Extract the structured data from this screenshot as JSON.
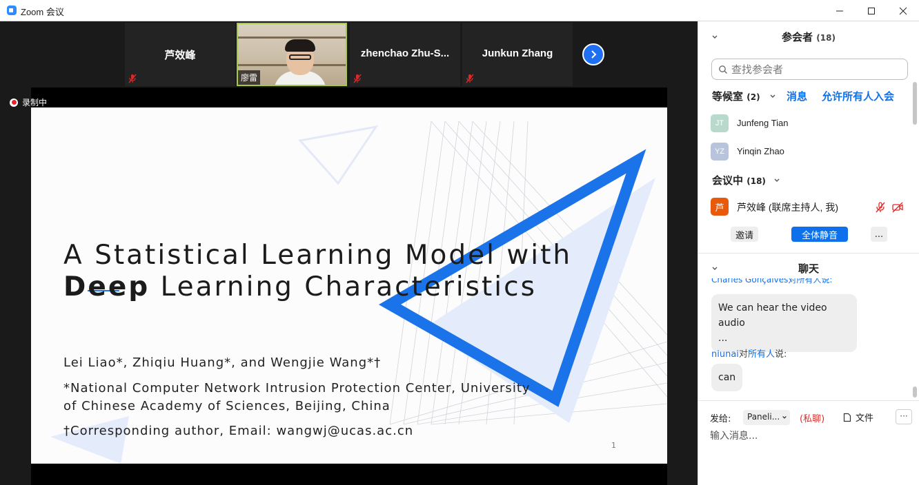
{
  "window": {
    "title": "Zoom 会议",
    "minimize_icon": "minimize-icon",
    "maximize_icon": "maximize-icon",
    "close_icon": "close-icon"
  },
  "participants_strip": [
    {
      "name": "芦效峰",
      "muted": true
    },
    {
      "name": "廖雷",
      "video": true
    },
    {
      "name": "zhenchao  Zhu-S...",
      "muted": true
    },
    {
      "name": "Junkun Zhang",
      "muted": true
    }
  ],
  "recording": {
    "label": "录制中"
  },
  "slide": {
    "title_line1": "A Statistical Learning Model with",
    "title_line2_bold": "Deep",
    "title_line2_rest": " Learning Characteristics",
    "authors": "Lei Liao*, Zhiqiu Huang*, and Wengjie Wang*†",
    "affiliation_line1": "*National Computer Network Intrusion Protection Center, University",
    "affiliation_line2": "of Chinese Academy of Sciences, Beijing, China",
    "corresponding": "†Corresponding author, Email: wangwj@ucas.ac.cn",
    "page_number": "1",
    "accent_color": "#1a73e8"
  },
  "panel": {
    "participants_header": "参会者",
    "participants_count": "(18)",
    "search_placeholder": "查找参会者",
    "waiting_room_label": "等候室",
    "waiting_room_count": "(2)",
    "message_link": "消息",
    "admit_all_link": "允许所有人入会",
    "waiting": [
      {
        "initials": "JT",
        "name": "Junfeng Tian",
        "color": "#b9d9cc"
      },
      {
        "initials": "YZ",
        "name": "Yinqin Zhao",
        "color": "#b8c4dc"
      }
    ],
    "in_meeting_label": "会议中",
    "in_meeting_count": "(18)",
    "host": {
      "initials": "芦",
      "name": "芦效峰 (联席主持人, 我)",
      "color": "#e8590c"
    },
    "invite_button": "邀请",
    "mute_all_button": "全体静音",
    "more_button": "...",
    "chat_header": "聊天",
    "chat_clipped_sender": "Charles Gonçalves对所有人说:",
    "chat_messages": [
      {
        "text": "We can hear the video audio\n..."
      },
      {
        "sender_name": "niunai",
        "sender_to": "对",
        "sender_target": "所有人",
        "sender_suffix": "说:",
        "text": "can"
      }
    ],
    "send_to_label": "发给:",
    "send_to_value": "Paneli...",
    "private_label": "(私聊)",
    "file_label": "文件",
    "more_footer": "···",
    "message_placeholder": "输入消息..."
  }
}
